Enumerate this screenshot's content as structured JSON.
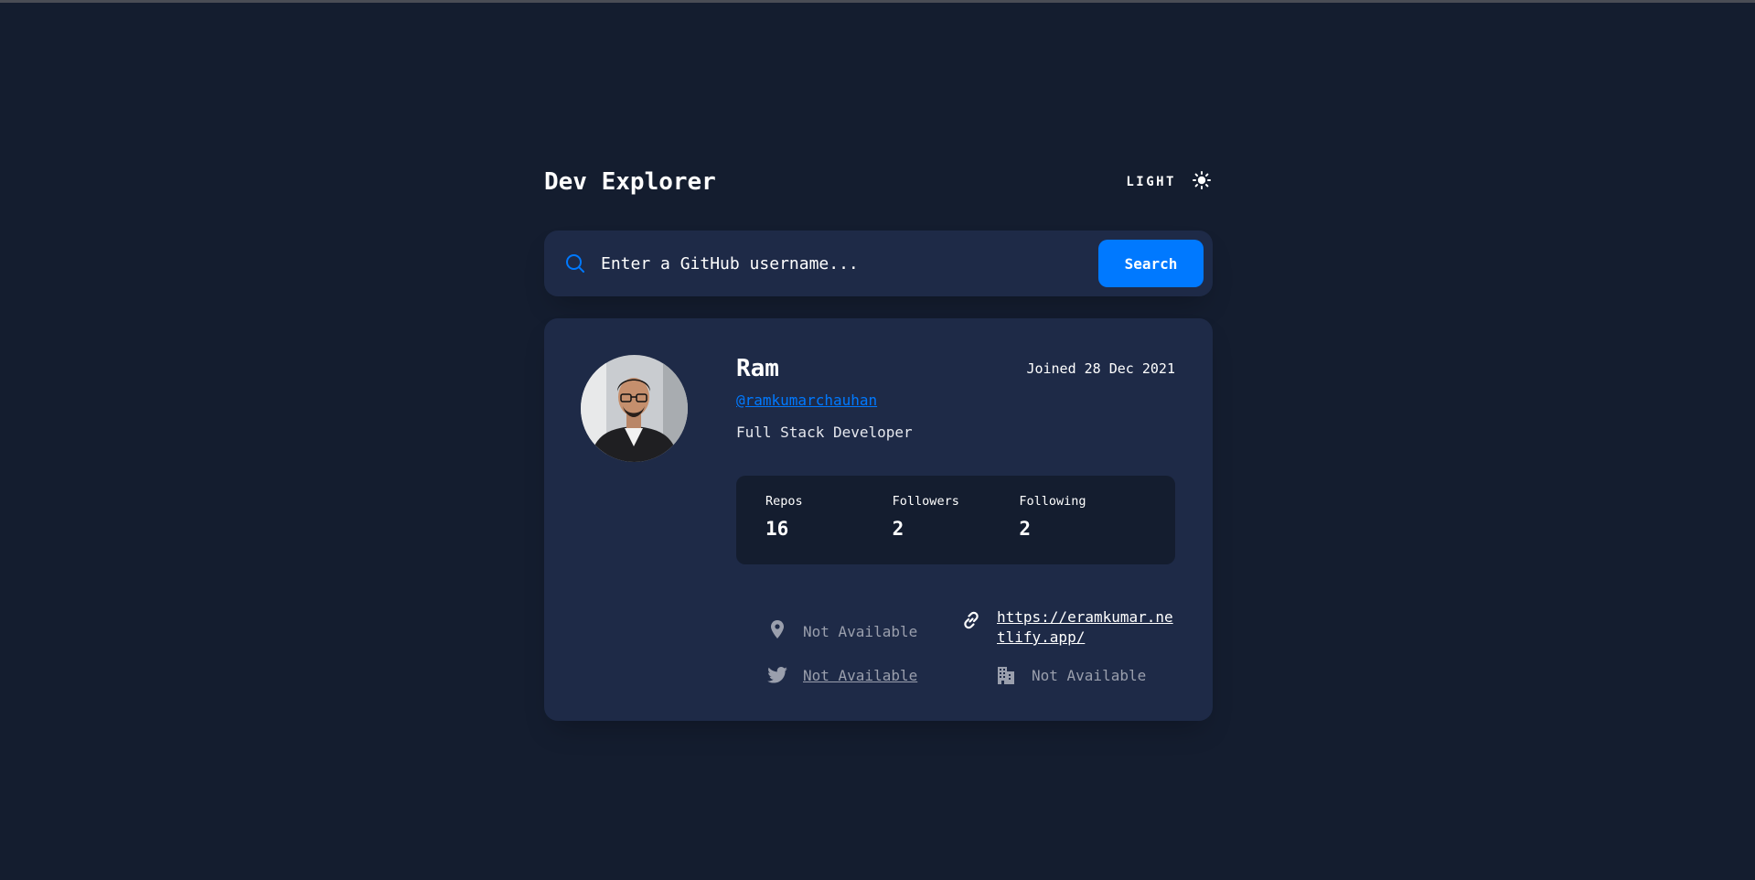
{
  "header": {
    "title": "Dev Explorer",
    "theme_label": "LIGHT",
    "theme_icon": "sun-icon"
  },
  "search": {
    "placeholder": "Enter a GitHub username...",
    "button_label": "Search",
    "icon": "search-icon"
  },
  "profile": {
    "name": "Ram",
    "handle": "@ramkumarchauhan",
    "joined": "Joined 28 Dec 2021",
    "bio": "Full Stack Developer",
    "stats": [
      {
        "label": "Repos",
        "value": "16"
      },
      {
        "label": "Followers",
        "value": "2"
      },
      {
        "label": "Following",
        "value": "2"
      }
    ],
    "links": {
      "location": {
        "icon": "location-pin-icon",
        "text": "Not Available"
      },
      "website": {
        "icon": "link-icon",
        "text": "https://eramkumar.netlify.app/"
      },
      "twitter": {
        "icon": "twitter-icon",
        "text": "Not Available"
      },
      "company": {
        "icon": "building-icon",
        "text": "Not Available"
      }
    }
  },
  "colors": {
    "background": "#141d2f",
    "card": "#1e2a47",
    "accent": "#0079ff",
    "muted": "#9a9fad"
  }
}
